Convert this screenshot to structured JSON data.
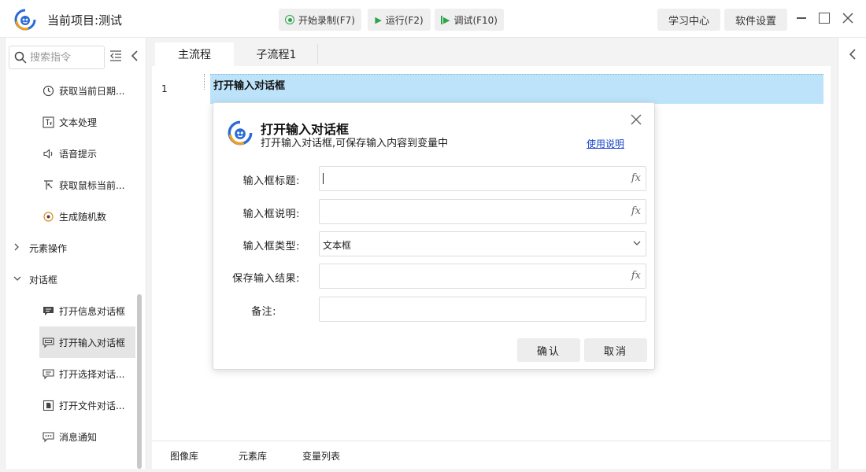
{
  "titlebar": {
    "project_title": "当前项目:测试",
    "record_label": "开始录制(F7)",
    "run_label": "运行(F2)",
    "debug_label": "调试(F10)",
    "learn_label": "学习中心",
    "settings_label": "软件设置"
  },
  "sidebar": {
    "search_placeholder": "搜索指令",
    "items": [
      {
        "label": "获取当前日期...",
        "icon": "clock-icon"
      },
      {
        "label": "文本处理",
        "icon": "text-icon"
      },
      {
        "label": "语音提示",
        "icon": "speaker-icon"
      },
      {
        "label": "获取鼠标当前...",
        "icon": "mouse-pointer-icon"
      },
      {
        "label": "生成随机数",
        "icon": "random-icon"
      }
    ],
    "groups": [
      {
        "label": "元素操作",
        "expanded": false
      },
      {
        "label": "对话框",
        "expanded": true
      }
    ],
    "dialog_items": [
      {
        "label": "打开信息对话框",
        "icon": "message-box-icon"
      },
      {
        "label": "打开输入对话框",
        "icon": "input-box-icon",
        "selected": true
      },
      {
        "label": "打开选择对话...",
        "icon": "select-box-icon"
      },
      {
        "label": "打开文件对话...",
        "icon": "file-box-icon"
      },
      {
        "label": "消息通知",
        "icon": "notify-icon"
      }
    ]
  },
  "main": {
    "tabs": [
      {
        "label": "主流程",
        "active": true
      },
      {
        "label": "子流程1",
        "active": false
      }
    ],
    "line_number": "1",
    "flow_step": "打开输入对话框"
  },
  "dialog": {
    "title": "打开输入对话框",
    "subtitle": "打开输入对话框,可保存输入内容到变量中",
    "help_link": "使用说明",
    "fields": {
      "title_label": "输入框标题:",
      "title_value": "",
      "desc_label": "输入框说明:",
      "desc_value": "",
      "type_label": "输入框类型:",
      "type_value": "文本框",
      "save_label": "保存输入结果:",
      "save_value": "",
      "note_label": "备注:",
      "note_value": ""
    },
    "fx_symbol": "fx",
    "confirm_label": "确认",
    "cancel_label": "取消"
  },
  "bottom_tabs": [
    "图像库",
    "元素库",
    "变量列表"
  ],
  "colors": {
    "accent_green": "#2aa54a",
    "selected_row": "#bde3fb",
    "link_blue": "#1a44c7"
  }
}
